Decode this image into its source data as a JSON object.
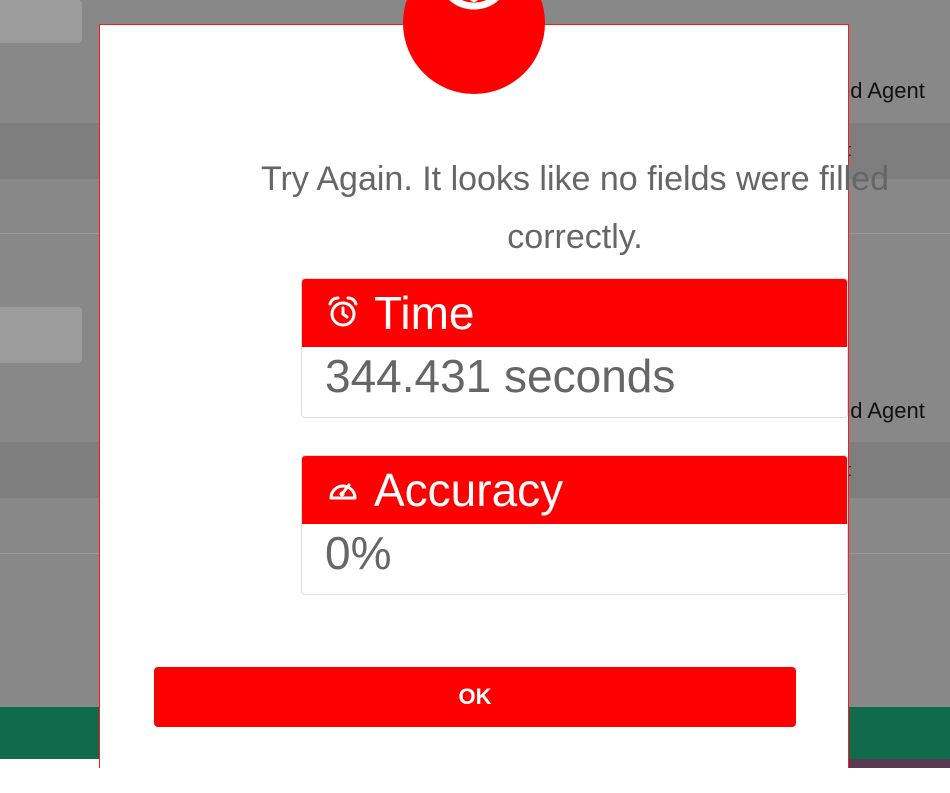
{
  "background": {
    "agent_label_1": "ed Agent",
    "agent_label_2": "ed Agent",
    "partial_glyph_1": "t",
    "partial_glyph_2": "t"
  },
  "modal": {
    "alert_icon": "exclamation-circle-icon",
    "message": "Try Again. It looks like no fields were filled correctly.",
    "time": {
      "icon": "alarm-clock-icon",
      "label": "Time",
      "value": "344.431 seconds"
    },
    "accuracy": {
      "icon": "speedometer-icon",
      "label": "Accuracy",
      "value": "0%"
    },
    "ok_label": "OK"
  },
  "colors": {
    "accent": "#ff0000",
    "text_muted": "#666666",
    "overlay_gray": "#888888",
    "footer_green": "#0f6b4c"
  }
}
